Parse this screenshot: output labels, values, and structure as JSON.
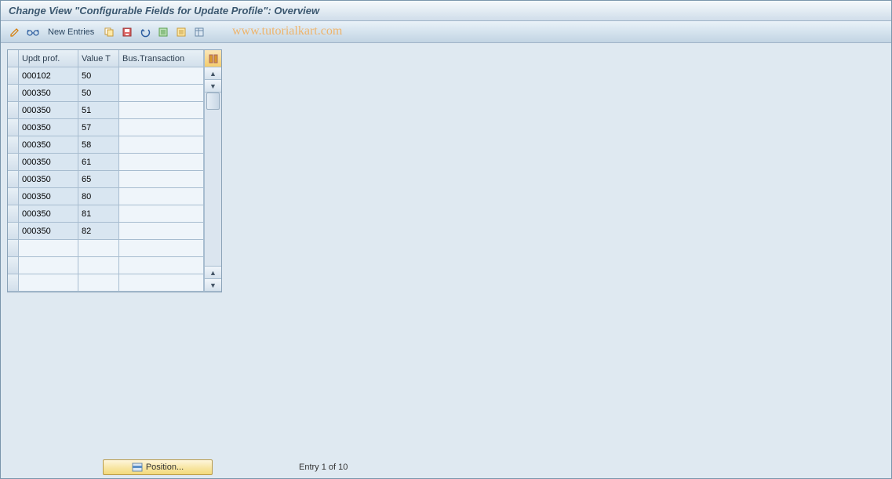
{
  "title": "Change View \"Configurable Fields for Update Profile\": Overview",
  "toolbar": {
    "new_entries": "New Entries"
  },
  "watermark": "www.tutorialkart.com",
  "table": {
    "headers": {
      "c1": "Updt prof.",
      "c2": "Value T",
      "c3": "Bus.Transaction"
    },
    "rows": [
      {
        "c1": "000102",
        "c2": "50",
        "c3": ""
      },
      {
        "c1": "000350",
        "c2": "50",
        "c3": ""
      },
      {
        "c1": "000350",
        "c2": "51",
        "c3": ""
      },
      {
        "c1": "000350",
        "c2": "57",
        "c3": ""
      },
      {
        "c1": "000350",
        "c2": "58",
        "c3": ""
      },
      {
        "c1": "000350",
        "c2": "61",
        "c3": ""
      },
      {
        "c1": "000350",
        "c2": "65",
        "c3": ""
      },
      {
        "c1": "000350",
        "c2": "80",
        "c3": ""
      },
      {
        "c1": "000350",
        "c2": "81",
        "c3": ""
      },
      {
        "c1": "000350",
        "c2": "82",
        "c3": ""
      }
    ],
    "empty_rows": 3
  },
  "footer": {
    "position_btn": "Position...",
    "entry_text": "Entry 1 of 10"
  }
}
